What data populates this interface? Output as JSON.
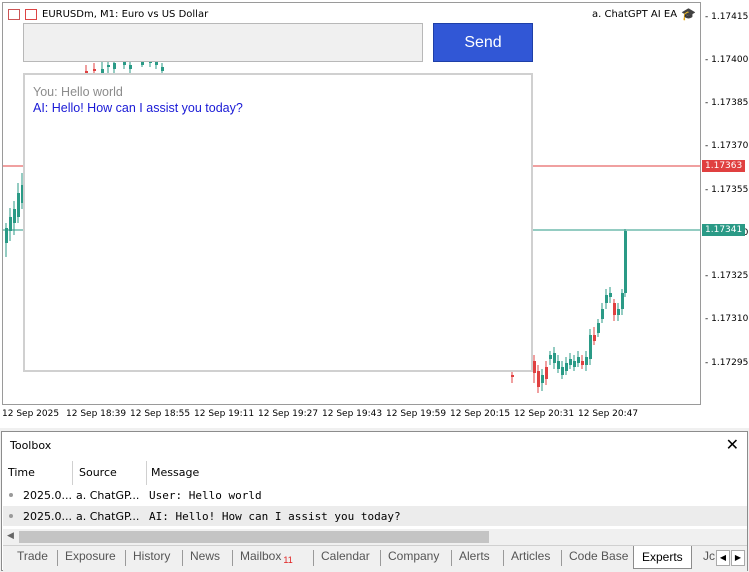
{
  "chart": {
    "symbol": "EURUSDm, M1:  Euro vs US Dollar",
    "expert": "a. ChatGPT AI EA",
    "price_labels": [
      "1.17415",
      "1.17400",
      "1.17385",
      "1.17370",
      "1.17355",
      "1.17340",
      "1.17325",
      "1.17310",
      "1.17295"
    ],
    "ask_price": "1.17363",
    "bid_price": "1.17341",
    "time_labels": [
      "12 Sep 2025",
      "12 Sep 18:39",
      "12 Sep 18:55",
      "12 Sep 19:11",
      "12 Sep 19:27",
      "12 Sep 19:43",
      "12 Sep 19:59",
      "12 Sep 20:15",
      "12 Sep 20:31",
      "12 Sep 20:47"
    ],
    "colors": {
      "ask_line": "#e04040",
      "bid_line": "#2a9a86",
      "bull": "#2a9a86",
      "bear": "#e04040"
    }
  },
  "chat": {
    "input_value": "",
    "send_label": "Send",
    "user_message": "You: Hello world",
    "ai_message": "AI: Hello! How can I assist you today?"
  },
  "toolbox": {
    "title": "Toolbox",
    "close": "✕",
    "columns": [
      "Time",
      "Source",
      "Message"
    ],
    "rows": [
      {
        "time": "2025.0...",
        "source": "a. ChatGP...",
        "message": "User: Hello world"
      },
      {
        "time": "2025.0...",
        "source": "a. ChatGP...",
        "message": "AI: Hello! How can I assist you today?"
      }
    ],
    "tabs": [
      {
        "label": "Trade"
      },
      {
        "label": "Exposure"
      },
      {
        "label": "History"
      },
      {
        "label": "News"
      },
      {
        "label": "Mailbox",
        "badge": "11"
      },
      {
        "label": "Calendar"
      },
      {
        "label": "Company"
      },
      {
        "label": "Alerts"
      },
      {
        "label": "Articles"
      },
      {
        "label": "Code Base"
      },
      {
        "label": "Experts"
      },
      {
        "label": "Jc"
      }
    ]
  }
}
